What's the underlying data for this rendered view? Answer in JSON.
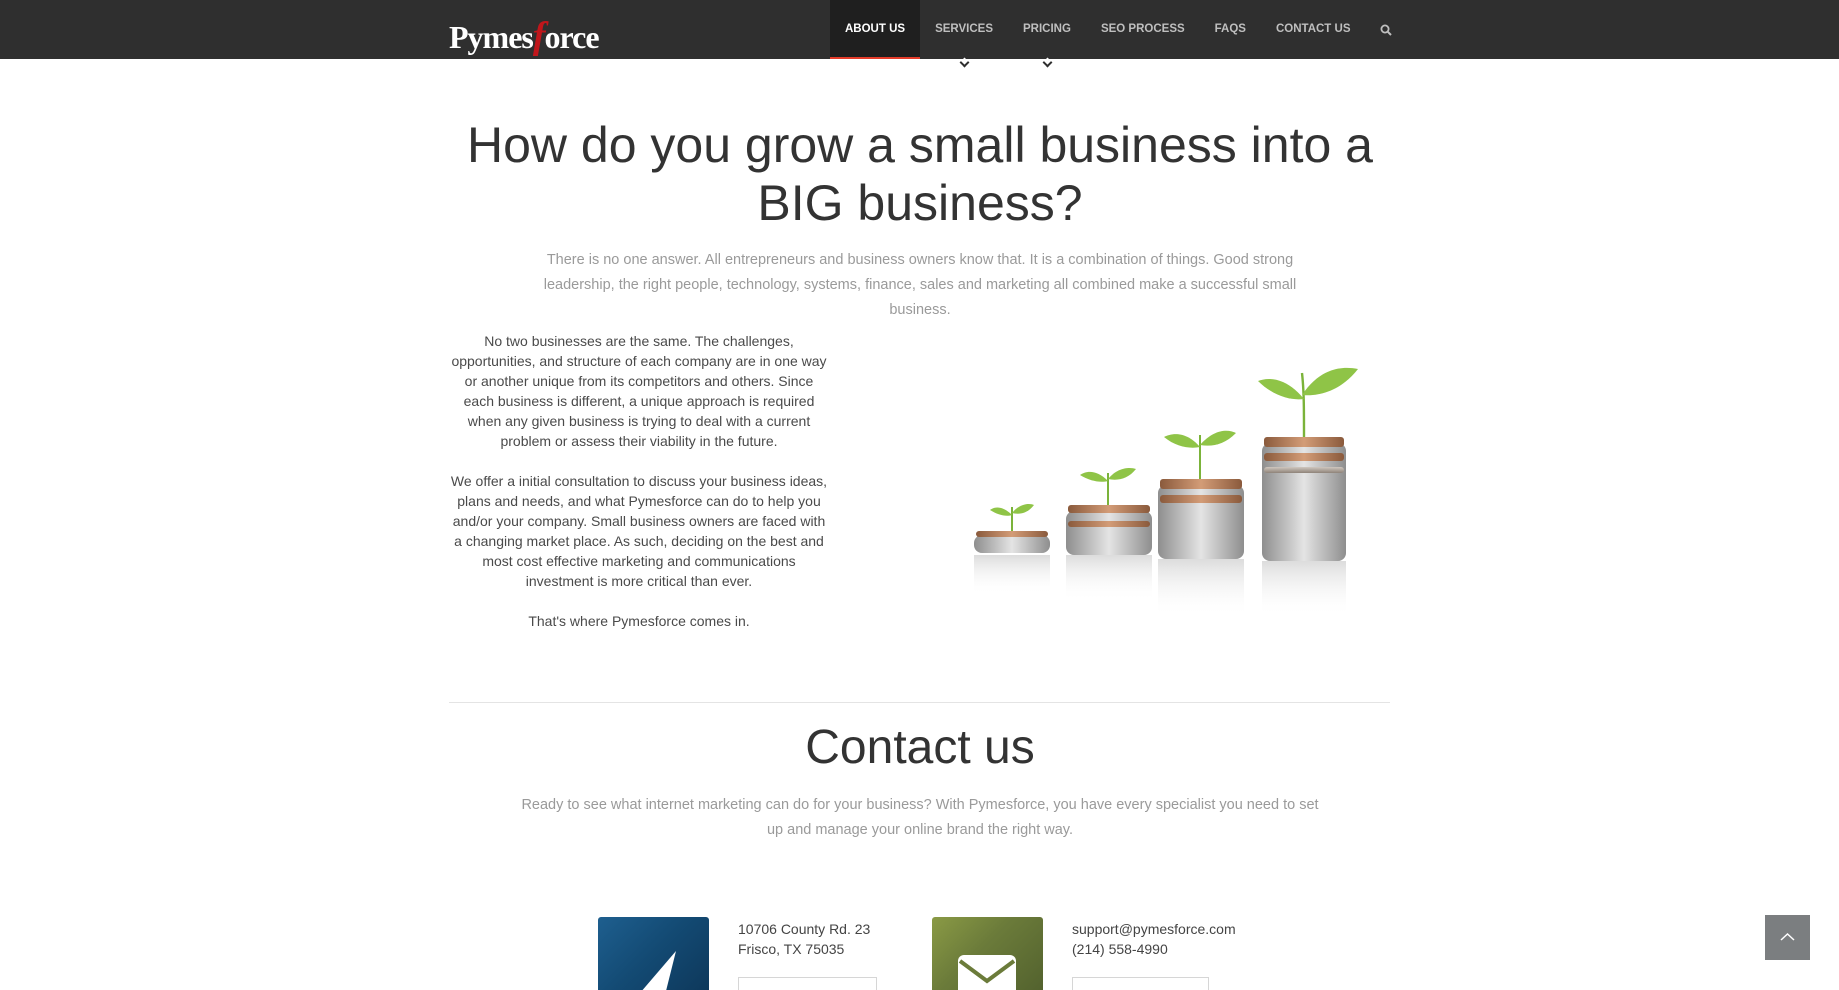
{
  "navbar": {
    "logo": {
      "text_left": "Pymes",
      "text_f": "f",
      "text_right": "orce"
    },
    "items": [
      {
        "label": "ABOUT US",
        "active": true
      },
      {
        "label": "SERVICES",
        "has_dropdown": true
      },
      {
        "label": "PRICING",
        "has_dropdown": true
      },
      {
        "label": "SEO PROCESS"
      },
      {
        "label": "FAQS"
      },
      {
        "label": "CONTACT US"
      }
    ],
    "search_icon": "search-icon"
  },
  "hero": {
    "title": "How do you grow a small business into a BIG business?",
    "lead": "There is no one answer. All entrepreneurs and business owners know that. It is a combination of things. Good strong leadership, the right people, technology, systems, finance, sales and marketing all combined make a successful small business."
  },
  "about": {
    "paragraphs": [
      "No two businesses are the same. The challenges, opportunities, and structure of each company are in one way or another unique from its competitors and others. Since each business is different, a unique approach is required when any given business is trying to deal with a current problem or assess their viability in the future.",
      "We offer a initial consultation to discuss your business ideas, plans and needs, and what Pymesforce can do to help you and/or your company. Small business owners are faced with a changing market place. As such, deciding on the best and most cost effective marketing and communications investment is more critical than ever.",
      "That's where Pymesforce comes in."
    ],
    "image": "coins-and-sprouts-illustration"
  },
  "contact": {
    "title": "Contact us",
    "lead": "Ready to see what internet marketing can do for your business? With Pymesforce, you have every specialist you need to set up and manage your online brand the right way.",
    "address": {
      "line1": "10706 County Rd. 23",
      "line2": "Frisco, TX 75035",
      "icon": "location-arrow-icon"
    },
    "email": {
      "line1": "support@pymesforce.com",
      "line2": "(214) 558-4990",
      "icon": "envelope-icon"
    }
  },
  "back_to_top": {
    "icon": "chevron-up-icon"
  },
  "colors": {
    "nav_bg": "#2f2f2f",
    "accent": "#e53c2a",
    "logo_red": "#c0161b"
  }
}
